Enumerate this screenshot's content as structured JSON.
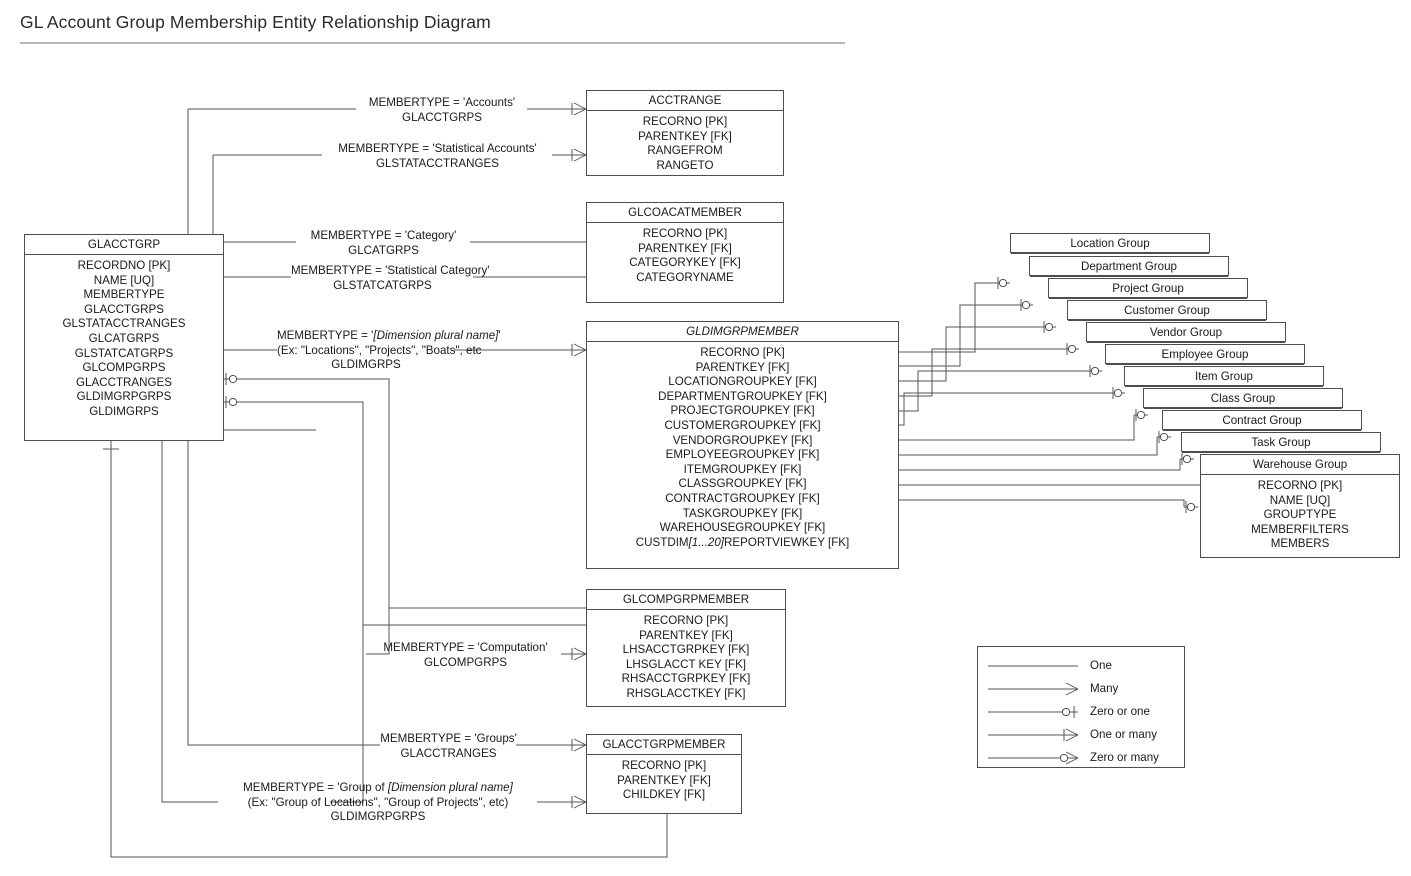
{
  "title": "GL Account Group Membership Entity Relationship Diagram",
  "entities": {
    "glacctgrp": {
      "name": "GLACCTGRP",
      "italic": false,
      "fields": [
        "RECORDNO [PK]",
        "NAME [UQ]",
        "MEMBERTYPE",
        "GLACCTGRPS",
        "GLSTATACCTRANGES",
        "GLCATGRPS",
        "GLSTATCATGRPS",
        "GLCOMPGRPS",
        "GLACCTRANGES",
        "GLDIMGRPGRPS",
        "GLDIMGRPS"
      ]
    },
    "acctrange": {
      "name": "ACCTRANGE",
      "italic": false,
      "fields": [
        "RECORNO [PK]",
        "PARENTKEY [FK]",
        "RANGEFROM",
        "RANGETO"
      ]
    },
    "glcoacatmember": {
      "name": "GLCOACATMEMBER",
      "italic": false,
      "fields": [
        "RECORNO [PK]",
        "PARENTKEY [FK]",
        "CATEGORYKEY [FK]",
        "CATEGORYNAME"
      ]
    },
    "gldimgrpmember": {
      "name": "GLDIMGRPMEMBER",
      "italic": true,
      "fields": [
        "RECORNO [PK]",
        "PARENTKEY [FK]",
        "LOCATIONGROUPKEY [FK]",
        "DEPARTMENTGROUPKEY [FK]",
        "PROJECTGROUPKEY [FK]",
        "CUSTOMERGROUPKEY [FK]",
        "VENDORGROUPKEY [FK]",
        "EMPLOYEEGROUPKEY [FK]",
        "ITEMGROUPKEY [FK]",
        "CLASSGROUPKEY [FK]",
        "CONTRACTGROUPKEY [FK]",
        "TASKGROUPKEY [FK]",
        "WAREHOUSEGROUPKEY [FK]",
        "CUSTDIM[1...20]REPORTVIEWKEY [FK]"
      ],
      "custdim_prefix": "CUSTDIM",
      "custdim_italic": "[1...20]",
      "custdim_suffix": "REPORTVIEWKEY [FK]"
    },
    "glcompgrpmember": {
      "name": "GLCOMPGRPMEMBER",
      "italic": false,
      "fields": [
        "RECORNO [PK]",
        "PARENTKEY [FK]",
        "LHSACCTGRPKEY [FK]",
        "LHSGLACCT KEY [FK]",
        "RHSACCTGRPKEY [FK]",
        "RHSGLACCTKEY  [FK]"
      ]
    },
    "glacctgrpmember": {
      "name": "GLACCTGRPMEMBER",
      "italic": false,
      "fields": [
        "RECORNO [PK]",
        "PARENTKEY [FK]",
        "CHILDKEY [FK]"
      ]
    }
  },
  "group_stack": {
    "names": [
      "Location Group",
      "Department Group",
      "Project Group",
      "Customer Group",
      "Vendor Group",
      "Employee Group",
      "Item Group",
      "Class Group",
      "Contract Group",
      "Task Group",
      "Warehouse Group"
    ],
    "fields": [
      "RECORNO [PK]",
      "NAME [UQ]",
      "GROUPTYPE",
      "MEMBERFILTERS",
      "MEMBERS"
    ]
  },
  "relationship_labels": [
    {
      "id": "accounts",
      "lines": [
        "MEMBERTYPE = 'Accounts'",
        "GLACCTGRPS"
      ]
    },
    {
      "id": "stat_accounts",
      "lines": [
        "MEMBERTYPE = 'Statistical Accounts'",
        "GLSTATACCTRANGES"
      ]
    },
    {
      "id": "category",
      "lines": [
        "MEMBERTYPE = 'Category'",
        "GLCATGRPS"
      ]
    },
    {
      "id": "stat_category",
      "lines": [
        "MEMBERTYPE = 'Statistical Category'",
        "GLSTATCATGRPS"
      ]
    },
    {
      "id": "dimension",
      "lines": [
        "MEMBERTYPE = '[Dimension plural name]'",
        "(Ex: \"Locations\", \"Projects\", \"Boats\", etc",
        "GLDIMGRPS"
      ]
    },
    {
      "id": "computation",
      "lines": [
        "MEMBERTYPE = 'Computation'",
        "GLCOMPGRPS"
      ]
    },
    {
      "id": "groups",
      "lines": [
        "MEMBERTYPE = 'Groups'",
        "GLACCTRANGES"
      ]
    },
    {
      "id": "group_of_dim",
      "lines": [
        "MEMBERTYPE = 'Group of [Dimension plural name]",
        "(Ex: \"Group of Locations\", \"Group of Projects\", etc)",
        "GLDIMGRPGRPS"
      ]
    }
  ],
  "label_parts": {
    "dimension_l1_pre": "MEMBERTYPE = '",
    "dimension_l1_it": "[Dimension plural name]",
    "dimension_l1_post": "'",
    "group_of_pre": "MEMBERTYPE = 'Group of ",
    "group_of_it": "[Dimension plural name]"
  },
  "legend": {
    "items": [
      {
        "label": "One",
        "marker": "one"
      },
      {
        "label": "Many",
        "marker": "many"
      },
      {
        "label": "Zero or one",
        "marker": "zero-or-one"
      },
      {
        "label": "One or many",
        "marker": "one-or-many"
      },
      {
        "label": "Zero or many",
        "marker": "zero-or-many"
      }
    ]
  },
  "colors": {
    "line": "#555555",
    "border": "#4d4d4d",
    "text": "#1a1a1a",
    "rule": "#b8b8b8",
    "background": "#ffffff"
  }
}
